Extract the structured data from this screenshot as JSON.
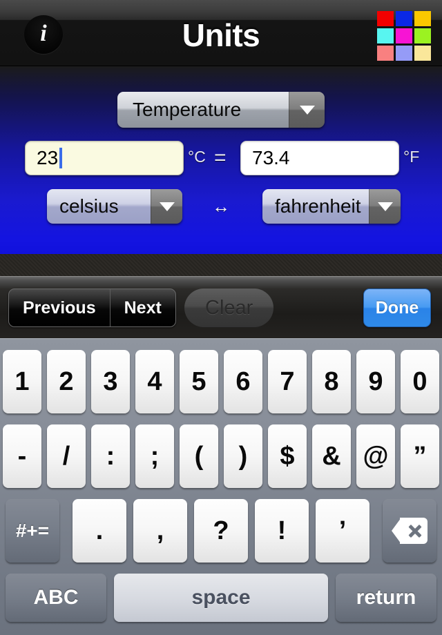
{
  "navbar": {
    "title": "Units",
    "info_button_glyph": "i",
    "info_icon_name": "info-icon",
    "palette_icon_name": "color-grid-icon",
    "palette_colors": [
      "#f20000",
      "#0a28e6",
      "#fbc800",
      "#58f5f0",
      "#f714d4",
      "#9bf221",
      "#f98080",
      "#959bf7",
      "#fae79a"
    ]
  },
  "panel": {
    "category": {
      "value": "Temperature",
      "caret_icon": "chevron-down-icon"
    },
    "from": {
      "value": "23",
      "unit_symbol": "°C",
      "unit_name": "celsius",
      "has_cursor": true
    },
    "equals_symbol": "=",
    "swap_symbol": "↔",
    "to": {
      "value": "73.4",
      "unit_symbol": "°F",
      "unit_name": "fahrenheit"
    }
  },
  "toolbar": {
    "previous_label": "Previous",
    "next_label": "Next",
    "clear_label": "Clear",
    "done_label": "Done",
    "accent_color": "#2f8ae9"
  },
  "keyboard": {
    "row1": [
      "1",
      "2",
      "3",
      "4",
      "5",
      "6",
      "7",
      "8",
      "9",
      "0"
    ],
    "row2": [
      "-",
      "/",
      ":",
      ";",
      "(",
      ")",
      "$",
      "&",
      "@",
      "”"
    ],
    "row3_symbol_key": "#+=",
    "row3": [
      ".",
      ",",
      "?",
      "!",
      "’"
    ],
    "row3_backspace_icon": "backspace-icon",
    "abc_label": "ABC",
    "space_label": "space",
    "return_label": "return"
  }
}
